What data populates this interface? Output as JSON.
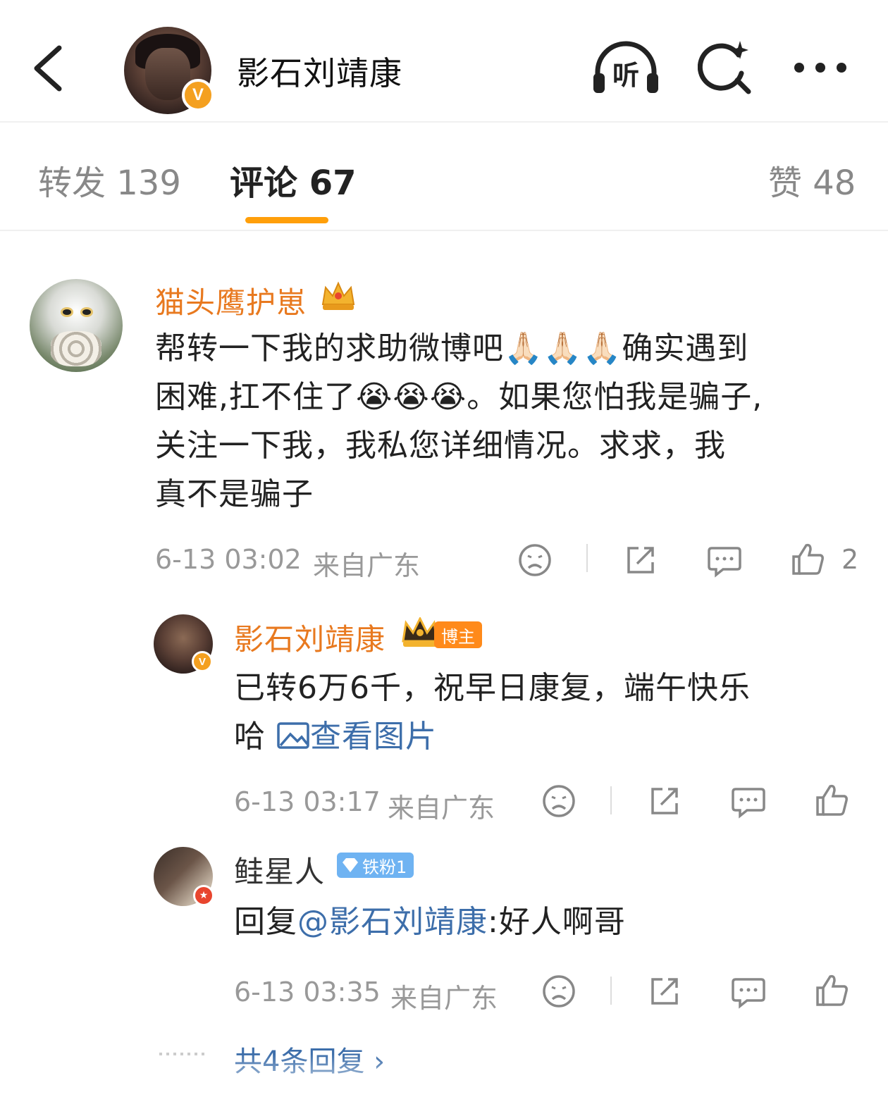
{
  "header": {
    "title": "影石刘靖康",
    "verified_badge": "V",
    "listen_label": "听",
    "icons": [
      "back-icon",
      "listen-icon",
      "search-sparkle-icon",
      "more-icon"
    ]
  },
  "tabs": [
    {
      "label": "转发 139"
    },
    {
      "label": "评论 67"
    },
    {
      "label": "赞 48"
    }
  ],
  "comment": {
    "user": "猫头鹰护崽",
    "text_line1": "帮转一下我的求助微博吧🙏🏻🙏🏻🙏🏻确实遇到",
    "text_line2": "困难,扛不住了😭😭😭。如果您怕我是骗子,",
    "text_line3": "关注一下我，我私您详细情况。求求，我",
    "text_line4": "真不是骗子",
    "time": "6-13 03:02",
    "location": "来自广东",
    "likes": "2"
  },
  "reply1": {
    "user": "影石刘靖康",
    "badge": "博主",
    "verified_badge": "V",
    "text_line1": "已转6万6千，祝早日康复，端午快乐",
    "text_line2_prefix": "哈 ",
    "image_link": "查看图片",
    "time": "6-13 03:17",
    "location": "来自广东"
  },
  "reply2": {
    "user": "鲑星人",
    "badge": "铁粉1",
    "prefix": "回复",
    "mention": "@影石刘靖康",
    "content": ":好人啊哥",
    "time": "6-13 03:35",
    "location": "来自广东"
  },
  "more_replies": "共4条回复 ›",
  "colors": {
    "accent": "#ff9f0a",
    "username_orange": "#e8791f",
    "link_blue": "#3d6eaa",
    "meta_gray": "#999999"
  }
}
